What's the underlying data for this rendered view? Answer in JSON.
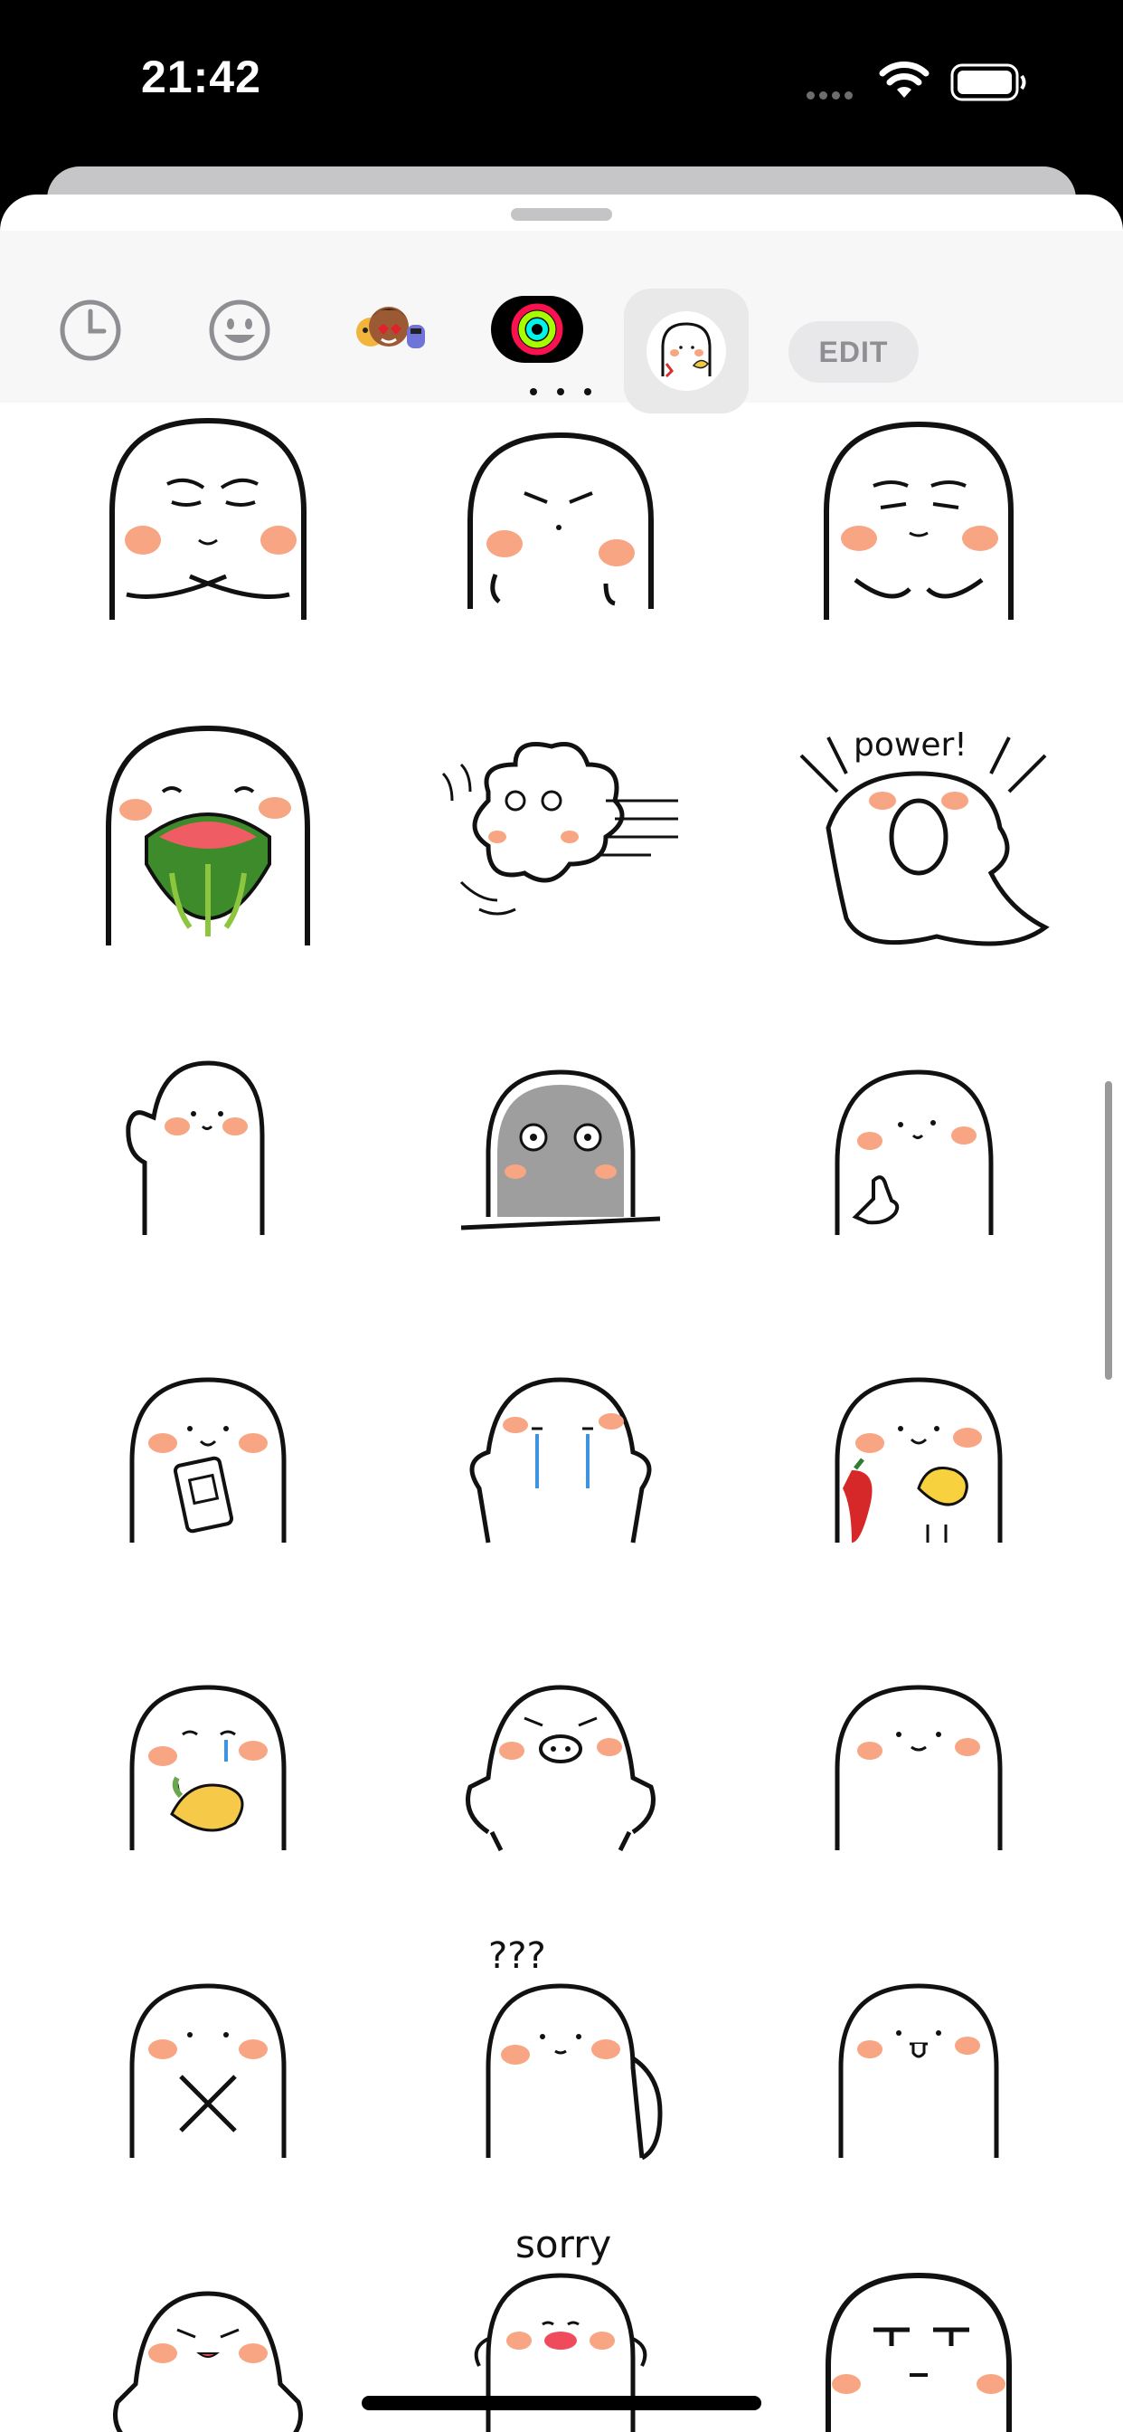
{
  "status_bar": {
    "time": "21:42"
  },
  "toolbar": {
    "recent_icon": "clock-icon",
    "emoji_icon": "smiley-face-icon",
    "memoji_icon": "memoji-stickers-icon",
    "activity_icon": "activity-rings-icon",
    "selected_pack_icon": "ghost-sticker-pack-icon",
    "edit_label": "EDIT"
  },
  "stickers": {
    "r6c2_text": "sorry",
    "r2c3_text": "power!",
    "r6c2_question": "???"
  },
  "colors": {
    "blush": "#f8a583",
    "status_bg": "#000000",
    "sheet_bg": "#ffffff",
    "toolbar_bg": "#f7f7f7"
  }
}
